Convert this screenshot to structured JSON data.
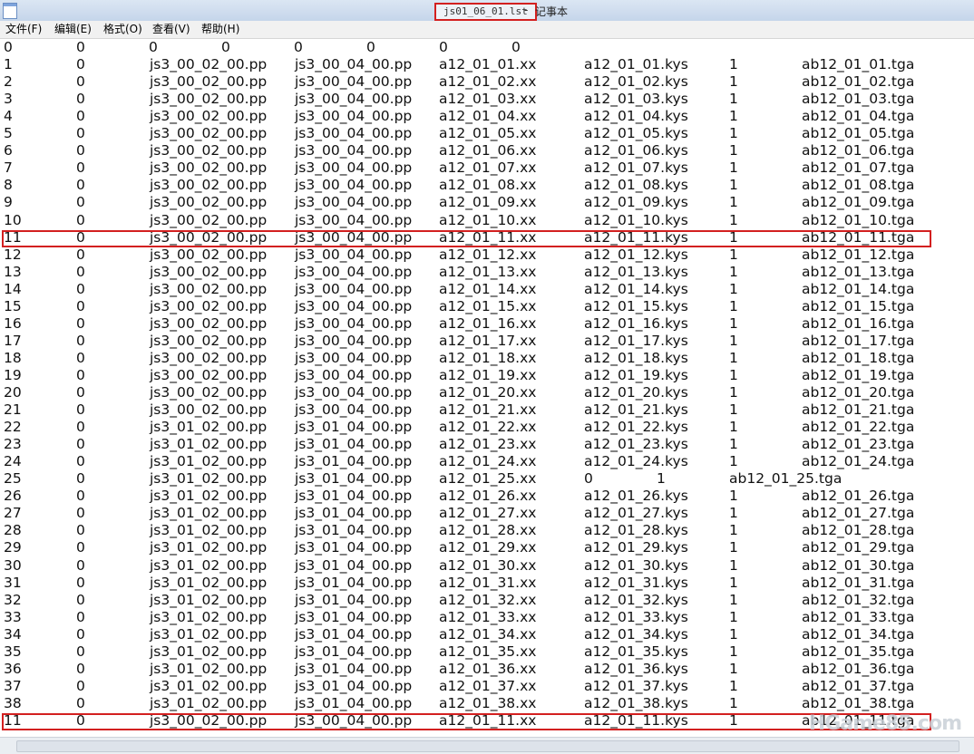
{
  "window": {
    "file_title": "js01_06_01.lst",
    "separator": "-",
    "app_name": "记事本"
  },
  "menu": [
    {
      "label": "文件(F)"
    },
    {
      "label": "编辑(E)"
    },
    {
      "label": "格式(O)"
    },
    {
      "label": "查看(V)"
    },
    {
      "label": "帮助(H)"
    }
  ],
  "highlighted_rows": [
    11,
    39
  ],
  "accent_color": "#d32020",
  "watermark": "HGame85.com",
  "lines": [
    [
      "0",
      "0",
      "0",
      "0",
      "0",
      "0",
      "0",
      "0"
    ],
    [
      "1",
      "0",
      "js3_00_02_00.pp",
      "js3_00_04_00.pp",
      "a12_01_01.xx",
      "a12_01_01.kys",
      "1",
      "ab12_01_01.tga"
    ],
    [
      "2",
      "0",
      "js3_00_02_00.pp",
      "js3_00_04_00.pp",
      "a12_01_02.xx",
      "a12_01_02.kys",
      "1",
      "ab12_01_02.tga"
    ],
    [
      "3",
      "0",
      "js3_00_02_00.pp",
      "js3_00_04_00.pp",
      "a12_01_03.xx",
      "a12_01_03.kys",
      "1",
      "ab12_01_03.tga"
    ],
    [
      "4",
      "0",
      "js3_00_02_00.pp",
      "js3_00_04_00.pp",
      "a12_01_04.xx",
      "a12_01_04.kys",
      "1",
      "ab12_01_04.tga"
    ],
    [
      "5",
      "0",
      "js3_00_02_00.pp",
      "js3_00_04_00.pp",
      "a12_01_05.xx",
      "a12_01_05.kys",
      "1",
      "ab12_01_05.tga"
    ],
    [
      "6",
      "0",
      "js3_00_02_00.pp",
      "js3_00_04_00.pp",
      "a12_01_06.xx",
      "a12_01_06.kys",
      "1",
      "ab12_01_06.tga"
    ],
    [
      "7",
      "0",
      "js3_00_02_00.pp",
      "js3_00_04_00.pp",
      "a12_01_07.xx",
      "a12_01_07.kys",
      "1",
      "ab12_01_07.tga"
    ],
    [
      "8",
      "0",
      "js3_00_02_00.pp",
      "js3_00_04_00.pp",
      "a12_01_08.xx",
      "a12_01_08.kys",
      "1",
      "ab12_01_08.tga"
    ],
    [
      "9",
      "0",
      "js3_00_02_00.pp",
      "js3_00_04_00.pp",
      "a12_01_09.xx",
      "a12_01_09.kys",
      "1",
      "ab12_01_09.tga"
    ],
    [
      "10",
      "0",
      "js3_00_02_00.pp",
      "js3_00_04_00.pp",
      "a12_01_10.xx",
      "a12_01_10.kys",
      "1",
      "ab12_01_10.tga"
    ],
    [
      "11",
      "0",
      "js3_00_02_00.pp",
      "js3_00_04_00.pp",
      "a12_01_11.xx",
      "a12_01_11.kys",
      "1",
      "ab12_01_11.tga"
    ],
    [
      "12",
      "0",
      "js3_00_02_00.pp",
      "js3_00_04_00.pp",
      "a12_01_12.xx",
      "a12_01_12.kys",
      "1",
      "ab12_01_12.tga"
    ],
    [
      "13",
      "0",
      "js3_00_02_00.pp",
      "js3_00_04_00.pp",
      "a12_01_13.xx",
      "a12_01_13.kys",
      "1",
      "ab12_01_13.tga"
    ],
    [
      "14",
      "0",
      "js3_00_02_00.pp",
      "js3_00_04_00.pp",
      "a12_01_14.xx",
      "a12_01_14.kys",
      "1",
      "ab12_01_14.tga"
    ],
    [
      "15",
      "0",
      "js3_00_02_00.pp",
      "js3_00_04_00.pp",
      "a12_01_15.xx",
      "a12_01_15.kys",
      "1",
      "ab12_01_15.tga"
    ],
    [
      "16",
      "0",
      "js3_00_02_00.pp",
      "js3_00_04_00.pp",
      "a12_01_16.xx",
      "a12_01_16.kys",
      "1",
      "ab12_01_16.tga"
    ],
    [
      "17",
      "0",
      "js3_00_02_00.pp",
      "js3_00_04_00.pp",
      "a12_01_17.xx",
      "a12_01_17.kys",
      "1",
      "ab12_01_17.tga"
    ],
    [
      "18",
      "0",
      "js3_00_02_00.pp",
      "js3_00_04_00.pp",
      "a12_01_18.xx",
      "a12_01_18.kys",
      "1",
      "ab12_01_18.tga"
    ],
    [
      "19",
      "0",
      "js3_00_02_00.pp",
      "js3_00_04_00.pp",
      "a12_01_19.xx",
      "a12_01_19.kys",
      "1",
      "ab12_01_19.tga"
    ],
    [
      "20",
      "0",
      "js3_00_02_00.pp",
      "js3_00_04_00.pp",
      "a12_01_20.xx",
      "a12_01_20.kys",
      "1",
      "ab12_01_20.tga"
    ],
    [
      "21",
      "0",
      "js3_00_02_00.pp",
      "js3_00_04_00.pp",
      "a12_01_21.xx",
      "a12_01_21.kys",
      "1",
      "ab12_01_21.tga"
    ],
    [
      "22",
      "0",
      "js3_01_02_00.pp",
      "js3_01_04_00.pp",
      "a12_01_22.xx",
      "a12_01_22.kys",
      "1",
      "ab12_01_22.tga"
    ],
    [
      "23",
      "0",
      "js3_01_02_00.pp",
      "js3_01_04_00.pp",
      "a12_01_23.xx",
      "a12_01_23.kys",
      "1",
      "ab12_01_23.tga"
    ],
    [
      "24",
      "0",
      "js3_01_02_00.pp",
      "js3_01_04_00.pp",
      "a12_01_24.xx",
      "a12_01_24.kys",
      "1",
      "ab12_01_24.tga"
    ],
    [
      "25",
      "0",
      "js3_01_02_00.pp",
      "js3_01_04_00.pp",
      "a12_01_25.xx",
      "0",
      "1",
      "ab12_01_25.tga"
    ],
    [
      "26",
      "0",
      "js3_01_02_00.pp",
      "js3_01_04_00.pp",
      "a12_01_26.xx",
      "a12_01_26.kys",
      "1",
      "ab12_01_26.tga"
    ],
    [
      "27",
      "0",
      "js3_01_02_00.pp",
      "js3_01_04_00.pp",
      "a12_01_27.xx",
      "a12_01_27.kys",
      "1",
      "ab12_01_27.tga"
    ],
    [
      "28",
      "0",
      "js3_01_02_00.pp",
      "js3_01_04_00.pp",
      "a12_01_28.xx",
      "a12_01_28.kys",
      "1",
      "ab12_01_28.tga"
    ],
    [
      "29",
      "0",
      "js3_01_02_00.pp",
      "js3_01_04_00.pp",
      "a12_01_29.xx",
      "a12_01_29.kys",
      "1",
      "ab12_01_29.tga"
    ],
    [
      "30",
      "0",
      "js3_01_02_00.pp",
      "js3_01_04_00.pp",
      "a12_01_30.xx",
      "a12_01_30.kys",
      "1",
      "ab12_01_30.tga"
    ],
    [
      "31",
      "0",
      "js3_01_02_00.pp",
      "js3_01_04_00.pp",
      "a12_01_31.xx",
      "a12_01_31.kys",
      "1",
      "ab12_01_31.tga"
    ],
    [
      "32",
      "0",
      "js3_01_02_00.pp",
      "js3_01_04_00.pp",
      "a12_01_32.xx",
      "a12_01_32.kys",
      "1",
      "ab12_01_32.tga"
    ],
    [
      "33",
      "0",
      "js3_01_02_00.pp",
      "js3_01_04_00.pp",
      "a12_01_33.xx",
      "a12_01_33.kys",
      "1",
      "ab12_01_33.tga"
    ],
    [
      "34",
      "0",
      "js3_01_02_00.pp",
      "js3_01_04_00.pp",
      "a12_01_34.xx",
      "a12_01_34.kys",
      "1",
      "ab12_01_34.tga"
    ],
    [
      "35",
      "0",
      "js3_01_02_00.pp",
      "js3_01_04_00.pp",
      "a12_01_35.xx",
      "a12_01_35.kys",
      "1",
      "ab12_01_35.tga"
    ],
    [
      "36",
      "0",
      "js3_01_02_00.pp",
      "js3_01_04_00.pp",
      "a12_01_36.xx",
      "a12_01_36.kys",
      "1",
      "ab12_01_36.tga"
    ],
    [
      "37",
      "0",
      "js3_01_02_00.pp",
      "js3_01_04_00.pp",
      "a12_01_37.xx",
      "a12_01_37.kys",
      "1",
      "ab12_01_37.tga"
    ],
    [
      "38",
      "0",
      "js3_01_02_00.pp",
      "js3_01_04_00.pp",
      "a12_01_38.xx",
      "a12_01_38.kys",
      "1",
      "ab12_01_38.tga"
    ],
    [
      "11",
      "0",
      "js3_00_02_00.pp",
      "js3_00_04_00.pp",
      "a12_01_11.xx",
      "a12_01_11.kys",
      "1",
      "ab12_01_11.tga"
    ]
  ]
}
